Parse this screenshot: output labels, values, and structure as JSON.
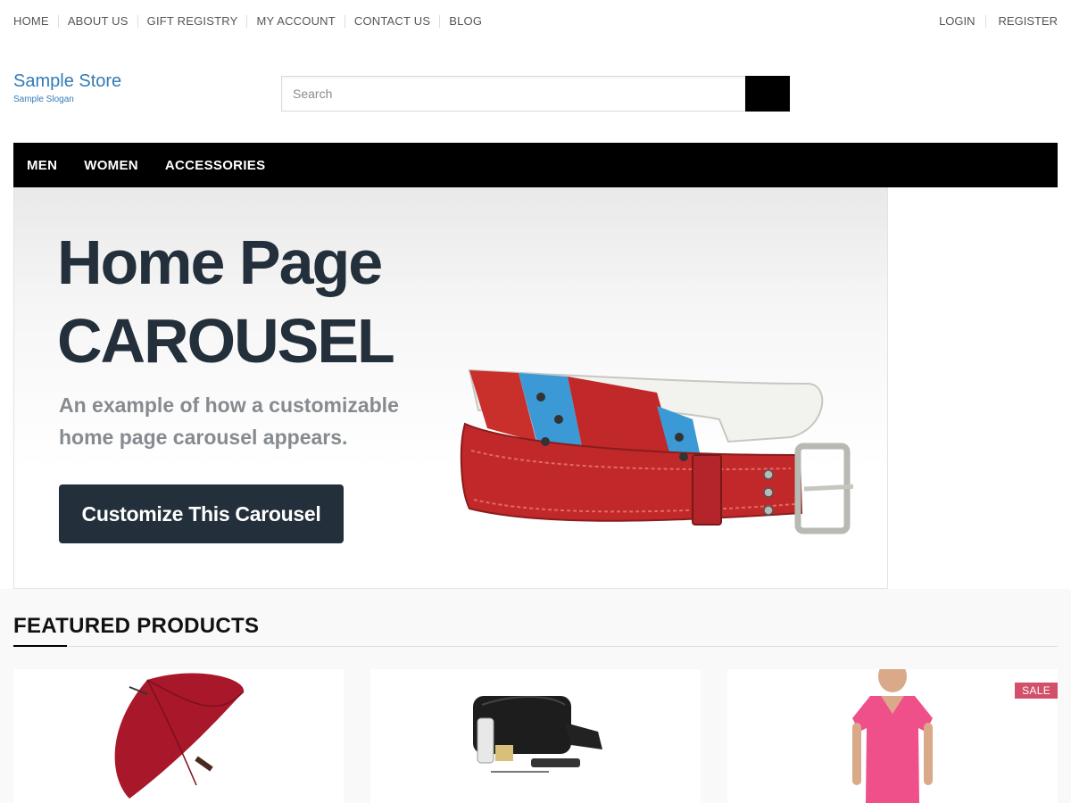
{
  "top_nav": {
    "items": [
      "HOME",
      "ABOUT US",
      "GIFT REGISTRY",
      "MY ACCOUNT",
      "CONTACT US",
      "BLOG"
    ]
  },
  "account": {
    "login": "LOGIN",
    "register": "REGISTER"
  },
  "store": {
    "name": "Sample Store",
    "slogan": "Sample Slogan"
  },
  "search": {
    "placeholder": "Search",
    "value": ""
  },
  "main_nav": {
    "items": [
      "MEN",
      "WOMEN",
      "ACCESSORIES"
    ]
  },
  "carousel": {
    "heading_line1": "Home Page",
    "heading_line2": "CAROUSEL",
    "description": "An example of how a customizable home page carousel appears.",
    "cta_label": "Customize This Carousel"
  },
  "featured": {
    "title": "FEATURED PRODUCTS",
    "products": [
      {
        "image": "red-umbrella"
      },
      {
        "image": "black-toiletry-bag"
      },
      {
        "image": "pink-t-shirt",
        "badge": "SALE"
      }
    ]
  },
  "colors": {
    "link": "#337ab7",
    "nav_bg": "#000000",
    "heading": "#232f3a",
    "sale_badge": "#d3506a"
  }
}
